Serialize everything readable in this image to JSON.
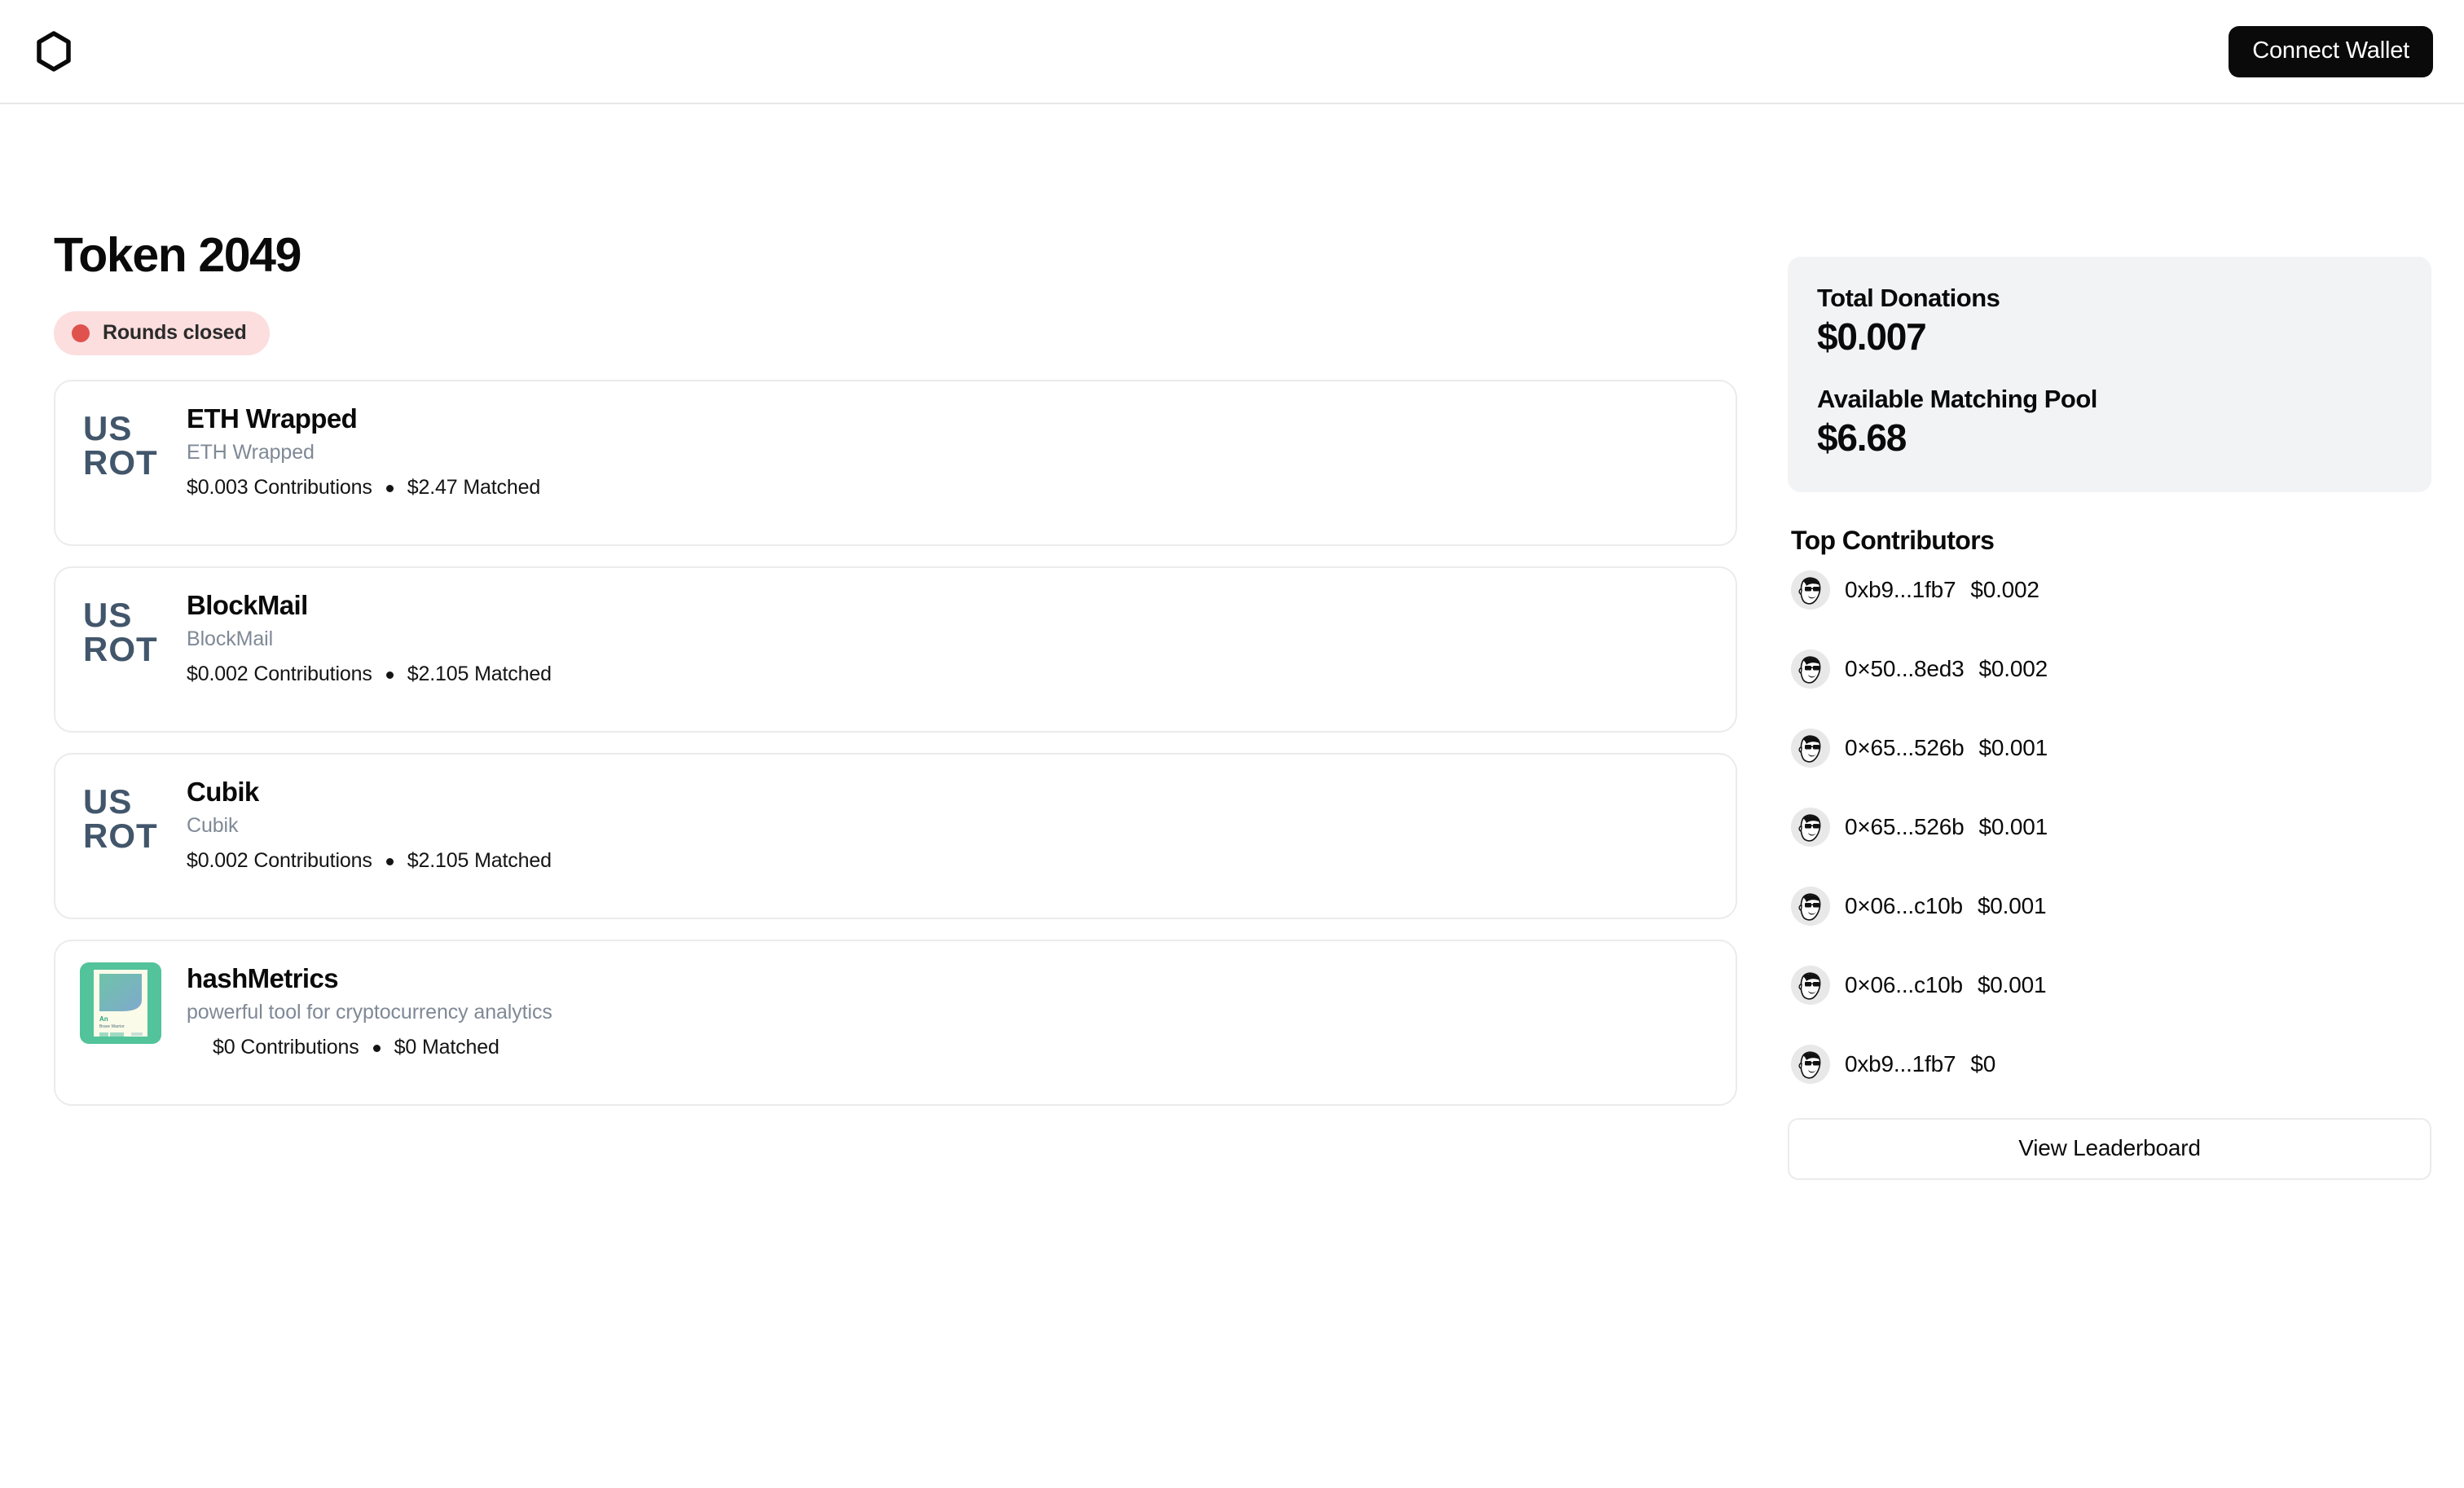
{
  "header": {
    "logo_icon": "hexagon-icon",
    "connect_wallet_label": "Connect Wallet"
  },
  "main": {
    "title": "Token 2049",
    "status_badge": {
      "label": "Rounds closed",
      "dot_color": "#e0524e",
      "background_color": "#fbdedd"
    },
    "projects": [
      {
        "name": "ETH Wrapped",
        "description": "ETH Wrapped",
        "contributions": "$0.003 Contributions",
        "matched": "$2.47 Matched",
        "logo_type": "usrot-wordmark"
      },
      {
        "name": "BlockMail",
        "description": "BlockMail",
        "contributions": "$0.002 Contributions",
        "matched": "$2.105 Matched",
        "logo_type": "usrot-wordmark"
      },
      {
        "name": "Cubik",
        "description": "Cubik",
        "contributions": "$0.002 Contributions",
        "matched": "$2.105 Matched",
        "logo_type": "usrot-wordmark"
      },
      {
        "name": "hashMetrics",
        "description": "powerful tool for cryptocurrency analytics",
        "contributions": "$0 Contributions",
        "matched": "$0 Matched",
        "logo_type": "green-poster",
        "logo_text_title": "An",
        "logo_text_sub": "Brave Warrior"
      }
    ]
  },
  "sidebar": {
    "stats": [
      {
        "label": "Total Donations",
        "value": "$0.007"
      },
      {
        "label": "Available Matching Pool",
        "value": "$6.68"
      }
    ],
    "panel_bg": "#f2f3f5",
    "contributors_heading": "Top Contributors",
    "contributors": [
      {
        "address": "0xb9...1fb7",
        "amount": "$0.002"
      },
      {
        "address": "0×50...8ed3",
        "amount": "$0.002"
      },
      {
        "address": "0×65...526b",
        "amount": "$0.001"
      },
      {
        "address": "0×65...526b",
        "amount": "$0.001"
      },
      {
        "address": "0×06...c10b",
        "amount": "$0.001"
      },
      {
        "address": "0×06...c10b",
        "amount": "$0.001"
      },
      {
        "address": "0xb9...1fb7",
        "amount": "$0"
      }
    ],
    "leaderboard_button_label": "View Leaderboard"
  }
}
